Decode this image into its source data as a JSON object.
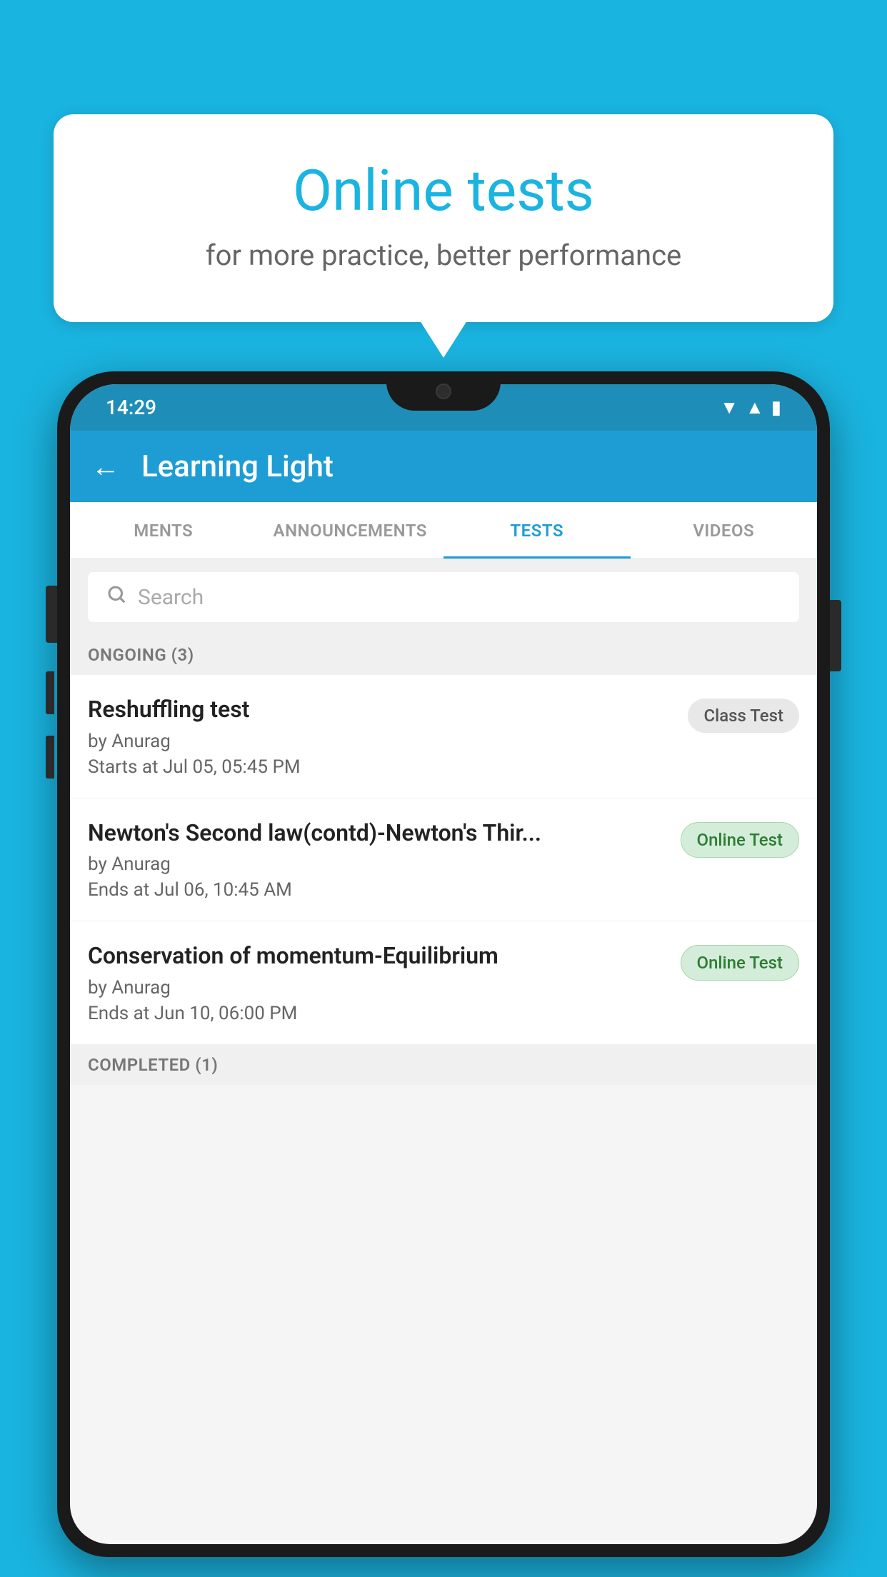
{
  "background_color": "#1ab4e0",
  "speech_bubble": {
    "title": "Online tests",
    "subtitle": "for more practice, better performance"
  },
  "status_bar": {
    "time": "14:29",
    "wifi": "▼",
    "signal": "▲",
    "battery": "▮"
  },
  "app_bar": {
    "title": "Learning Light",
    "back_label": "←"
  },
  "tabs": [
    {
      "label": "MENTS",
      "active": false
    },
    {
      "label": "ANNOUNCEMENTS",
      "active": false
    },
    {
      "label": "TESTS",
      "active": true
    },
    {
      "label": "VIDEOS",
      "active": false
    }
  ],
  "search": {
    "placeholder": "Search"
  },
  "ongoing_section": {
    "label": "ONGOING (3)"
  },
  "tests": [
    {
      "name": "Reshuffling test",
      "by": "by Anurag",
      "date_label": "Starts at",
      "date": "Jul 05, 05:45 PM",
      "badge": "Class Test",
      "badge_type": "class"
    },
    {
      "name": "Newton's Second law(contd)-Newton's Thir...",
      "by": "by Anurag",
      "date_label": "Ends at",
      "date": "Jul 06, 10:45 AM",
      "badge": "Online Test",
      "badge_type": "online"
    },
    {
      "name": "Conservation of momentum-Equilibrium",
      "by": "by Anurag",
      "date_label": "Ends at",
      "date": "Jun 10, 06:00 PM",
      "badge": "Online Test",
      "badge_type": "online"
    }
  ],
  "completed_section": {
    "label": "COMPLETED (1)"
  }
}
